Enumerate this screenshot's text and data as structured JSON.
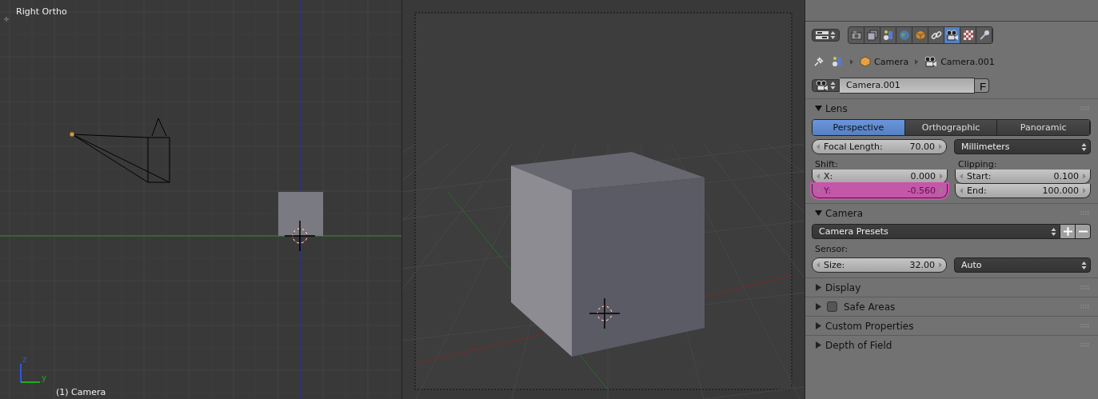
{
  "left_viewport": {
    "title": "Right Ortho",
    "object_label": "(1) Camera",
    "axis_labels": [
      "z",
      "y"
    ]
  },
  "properties": {
    "context_tabs": [
      {
        "kind": "render",
        "selected": false
      },
      {
        "kind": "layers",
        "selected": false
      },
      {
        "kind": "scene",
        "selected": false
      },
      {
        "kind": "world",
        "selected": false
      },
      {
        "kind": "object",
        "selected": false
      },
      {
        "kind": "constraints",
        "selected": false
      },
      {
        "kind": "data",
        "selected": true
      },
      {
        "kind": "texture",
        "selected": false
      },
      {
        "kind": "tool",
        "selected": false
      }
    ],
    "breadcrumb": [
      "Camera",
      "Camera.001"
    ],
    "datablock": {
      "name": "Camera.001",
      "fake_user": "F"
    },
    "lens": {
      "title": "Lens",
      "expanded": true,
      "projection_tabs": [
        {
          "label": "Perspective",
          "selected": true
        },
        {
          "label": "Orthographic",
          "selected": false
        },
        {
          "label": "Panoramic",
          "selected": false
        }
      ],
      "focal_length": {
        "label": "Focal Length:",
        "value": "70.00"
      },
      "unit": "Millimeters",
      "shift": {
        "label": "Shift:",
        "fields": [
          {
            "label": "X:",
            "value": "0.000",
            "highlighted": false
          },
          {
            "label": "Y:",
            "value": "-0.560",
            "highlighted": true
          }
        ]
      },
      "clipping": {
        "label": "Clipping:",
        "fields": [
          {
            "label": "Start:",
            "value": "0.100",
            "highlighted": false
          },
          {
            "label": "End:",
            "value": "100.000",
            "highlighted": false
          }
        ]
      }
    },
    "camera": {
      "title": "Camera",
      "expanded": true,
      "presets": "Camera Presets",
      "sensor_label": "Sensor:",
      "size": {
        "label": "Size:",
        "value": "32.00"
      },
      "fit": "Auto"
    },
    "collapsed_panels": [
      {
        "title": "Display",
        "expanded": false
      },
      {
        "title": "Safe Areas",
        "expanded": false,
        "checked": false
      },
      {
        "title": "Custom Properties",
        "expanded": false
      },
      {
        "title": "Depth of Field",
        "expanded": false
      }
    ]
  }
}
